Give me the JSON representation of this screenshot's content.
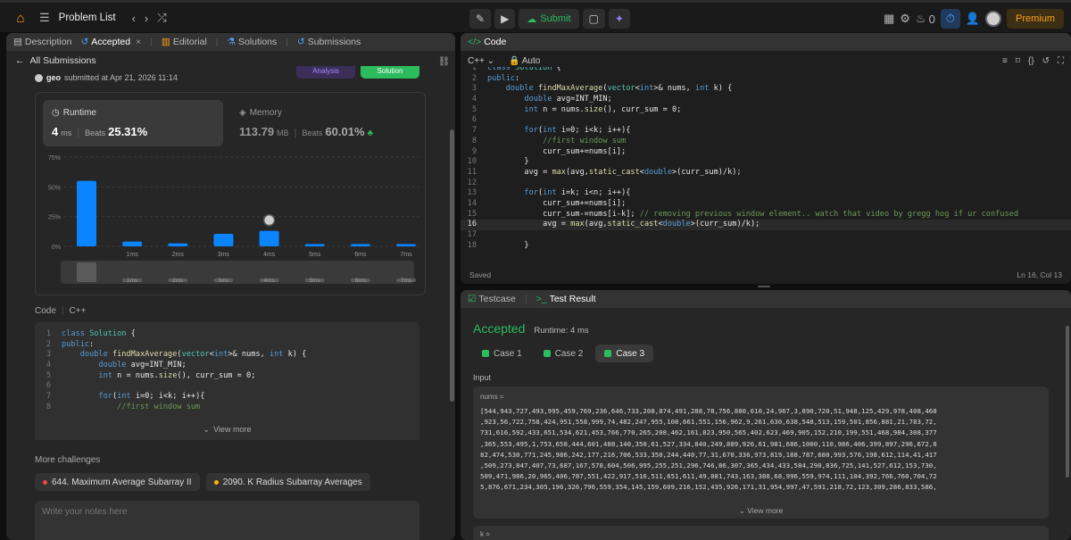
{
  "topbar": {
    "problem_list": "Problem List",
    "submit": "Submit",
    "streak": "0",
    "premium": "Premium"
  },
  "left": {
    "tabs": [
      "Description",
      "Accepted",
      "Editorial",
      "Solutions",
      "Submissions"
    ],
    "back_label": "All Submissions",
    "user": "geo",
    "submitted_text": "submitted at Apr 21, 2026 11:14",
    "analysis_btn": "Analysis",
    "solution_btn": "Solution",
    "runtime": {
      "label": "Runtime",
      "value": "4",
      "unit": "ms",
      "beats_label": "Beats",
      "beats": "25.31%"
    },
    "memory": {
      "label": "Memory",
      "value": "113.79",
      "unit": "MB",
      "beats_label": "Beats",
      "beats": "60.01%"
    },
    "code_label": "Code",
    "lang": "C++",
    "view_more": "View more",
    "more_challenges": "More challenges",
    "challenges": [
      {
        "label": "644. Maximum Average Subarray II",
        "color": "#ef4743"
      },
      {
        "label": "2090. K Radius Subarray Averages",
        "color": "#ffb800"
      }
    ],
    "notes_placeholder": "Write your notes here"
  },
  "chart_data": {
    "type": "bar",
    "yticks": [
      "75%",
      "50%",
      "25%",
      "0%"
    ],
    "ylim": [
      0,
      75
    ],
    "categories": [
      "",
      "1ms",
      "2ms",
      "3ms",
      "4ms",
      "5ms",
      "6ms",
      "7ms"
    ],
    "values": [
      55,
      4,
      2.5,
      10.5,
      13,
      2,
      2,
      2
    ],
    "highlight_index": 4,
    "accent": "#0a84ff"
  },
  "code_snippet": [
    [
      "1",
      "class Solution {"
    ],
    [
      "2",
      "public:"
    ],
    [
      "3",
      "    double findMaxAverage(vector<int>& nums, int k) {"
    ],
    [
      "4",
      "        double avg=INT_MIN;"
    ],
    [
      "5",
      "        int n = nums.size(), curr_sum = 0;"
    ],
    [
      "6",
      ""
    ],
    [
      "7",
      "        for(int i=0; i<k; i++){"
    ],
    [
      "8",
      "            //first window sum"
    ]
  ],
  "editor": {
    "title": "Code",
    "lang": "C++",
    "mode": "Auto",
    "saved": "Saved",
    "position": "Ln 16, Col 13",
    "lines": [
      [
        "1",
        "class Solution {"
      ],
      [
        "2",
        "public:"
      ],
      [
        "3",
        "    double findMaxAverage(vector<int>& nums, int k) {"
      ],
      [
        "4",
        "        double avg=INT_MIN;"
      ],
      [
        "5",
        "        int n = nums.size(), curr_sum = 0;"
      ],
      [
        "6",
        ""
      ],
      [
        "7",
        "        for(int i=0; i<k; i++){"
      ],
      [
        "8",
        "            //first window sum"
      ],
      [
        "9",
        "            curr_sum+=nums[i];"
      ],
      [
        "10",
        "        }"
      ],
      [
        "11",
        "        avg = max(avg,static_cast<double>(curr_sum)/k);"
      ],
      [
        "12",
        ""
      ],
      [
        "13",
        "        for(int i=k; i<n; i++){"
      ],
      [
        "14",
        "            curr_sum+=nums[i];"
      ],
      [
        "15",
        "            curr_sum-=nums[i-k]; // removing previous window element.. watch that video by gregg hog if ur confused"
      ],
      [
        "16",
        "            avg = max(avg,static_cast<double>(curr_sum)/k);"
      ],
      [
        "17",
        ""
      ],
      [
        "18",
        "        }"
      ]
    ]
  },
  "result": {
    "tab_testcase": "Testcase",
    "tab_result": "Test Result",
    "status": "Accepted",
    "runtime": "Runtime: 4 ms",
    "cases": [
      "Case 1",
      "Case 2",
      "Case 3"
    ],
    "input_label": "Input",
    "var_nums": "nums =",
    "var_k": "k =",
    "nums_lines": [
      "[544,943,727,493,995,459,769,236,646,733,208,874,491,288,78,756,880,610,24,967,3,890,720,51,948,125,429,978,408,468",
      ",923,56,722,758,424,951,558,999,74,482,247,955,108,661,551,156,962,9,261,630,638,548,513,159,501,856,881,21,783,72,",
      "731,616,592,433,651,534,621,453,766,770,265,208,462,161,823,950,565,402,623,469,905,152,210,199,551,468,984,308,377",
      ",365,553,495,1,753,658,444,601,488,140,350,61,527,334,840,249,889,926,61,981,686,1000,110,986,406,399,897,296,672,8",
      "82,474,530,771,245,986,242,177,216,706,533,350,244,440,77,31,670,336,973,819,188,787,680,993,576,198,612,114,41,417",
      ",509,273,847,407,73,687,167,578,604,506,995,255,251,296,746,86,307,365,434,433,584,290,836,725,141,527,612,153,730,",
      "509,471,986,20,965,406,787,551,422,917,516,511,651,611,49,881,743,163,388,68,996,559,974,111,104,392,766,760,704,72",
      "5,876,671,234,305,196,326,796,559,354,145,159,609,216,152,435,926,171,31,954,997,47,591,218,72,123,309,286,833,586,"
    ],
    "view_more": "View more"
  }
}
